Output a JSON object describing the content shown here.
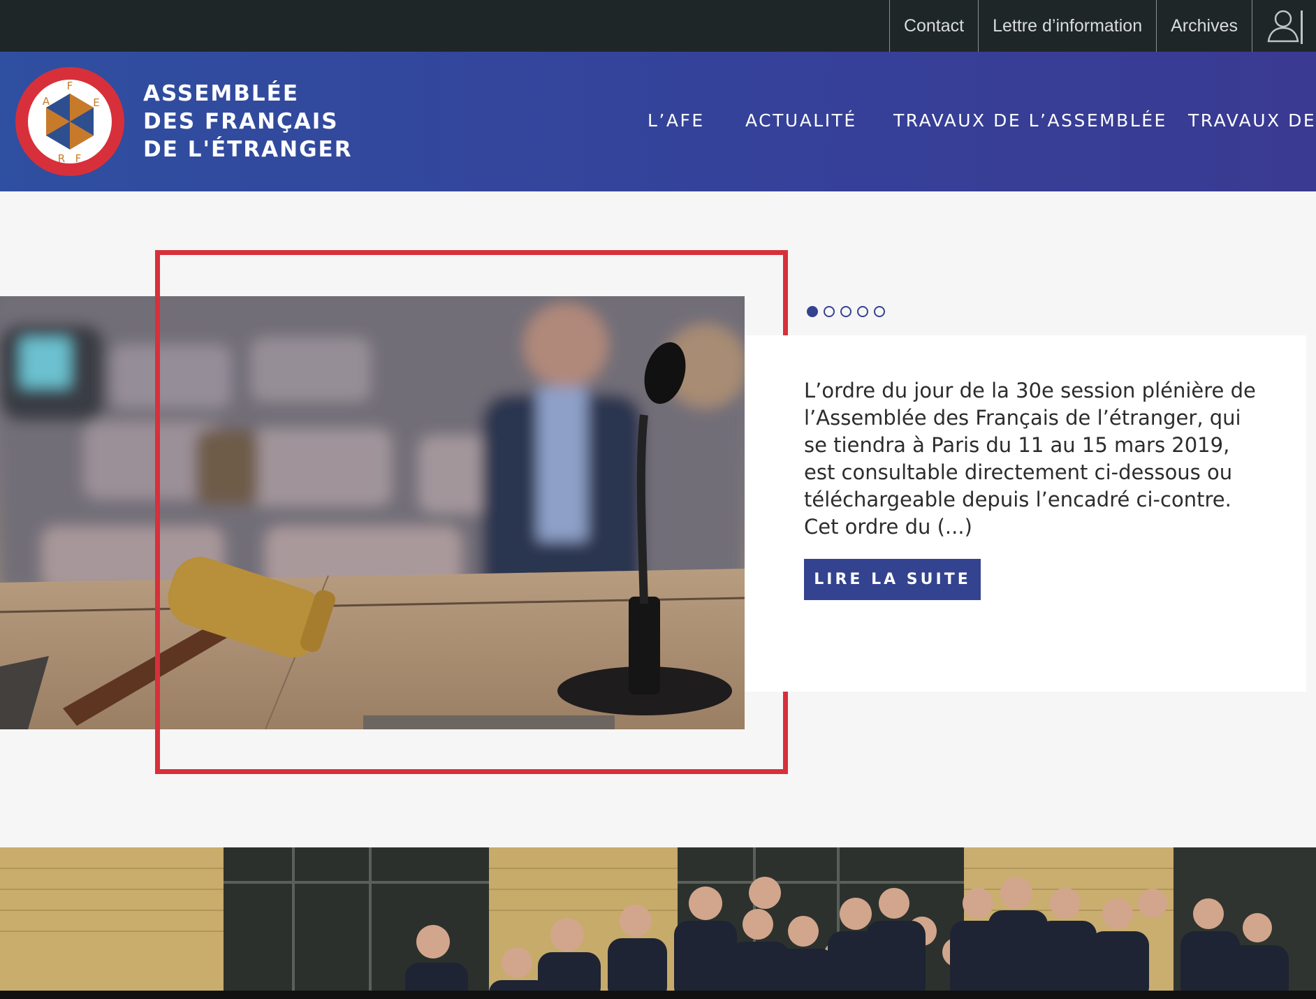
{
  "topbar": {
    "links": [
      {
        "label": "Contact"
      },
      {
        "label": "Lettre d’information"
      },
      {
        "label": "Archives"
      }
    ],
    "user_icon": "user-icon"
  },
  "header": {
    "logo_icon": "afe-logo",
    "logo_letters": [
      "A",
      "F",
      "E",
      "R",
      "F"
    ],
    "title_lines": [
      "ASSEMBLÉE",
      "DES FRANÇAIS",
      "DE L'ÉTRANGER"
    ],
    "nav": [
      {
        "label": "L’AFE"
      },
      {
        "label": "ACTUALITÉ"
      },
      {
        "label": "TRAVAUX DE L’ASSEMBLÉE"
      },
      {
        "label": "TRAVAUX DES"
      }
    ]
  },
  "slider": {
    "image_icon": "gavel-microphone-photo",
    "dots_count": 5,
    "active_dot": 1,
    "text": "L’ordre du jour de la 30e session plénière de l’Assemblée des Français de l’étranger, qui se tiendra à Paris du 11 au 15 mars 2019, est consultable directement ci-dessous ou téléchargeable depuis l’encadré ci-contre. Cet ordre du (...)",
    "button_label": "LIRE LA SUITE"
  },
  "colors": {
    "topbar": "#1f2627",
    "header": "#33438f",
    "accent": "#33438f",
    "highlight": "#d7303b",
    "logo_ring": "#d7303b"
  },
  "group_photo_icon": "group-photo"
}
